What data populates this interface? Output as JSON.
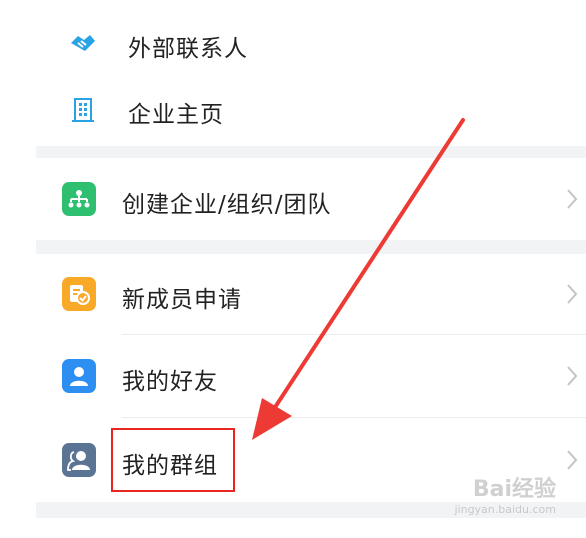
{
  "menu": {
    "external_contacts": "外部联系人",
    "company_homepage": "企业主页",
    "create_org": "创建企业/组织/团队",
    "new_member_requests": "新成员申请",
    "my_friends": "我的好友",
    "my_groups": "我的群组"
  },
  "icons": {
    "external_contacts": "handshake-icon",
    "company_homepage": "building-icon",
    "create_org": "org-chart-icon",
    "new_member_requests": "member-application-icon",
    "my_friends": "person-icon",
    "my_groups": "group-icon"
  },
  "colors": {
    "blue_icon": "#29a3e6",
    "green_icon": "#2fbf71",
    "orange_icon": "#f8a928",
    "friend_blue": "#2e8ff3",
    "group_slate": "#5c7493",
    "annotation_red": "#e8261f"
  },
  "watermark": {
    "brand": "Bai经验",
    "url": "jingyan.baidu.com"
  }
}
